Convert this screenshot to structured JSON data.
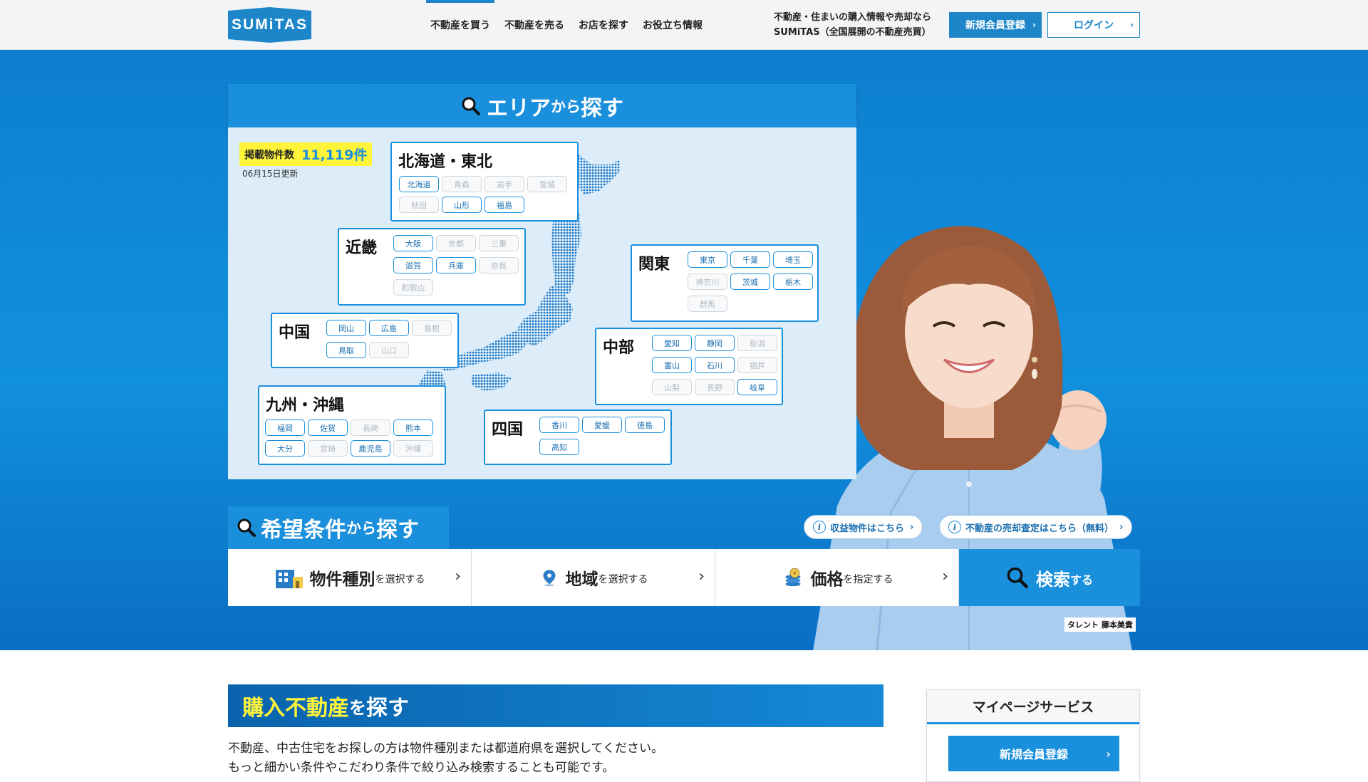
{
  "header": {
    "logo": "SUMiTAS",
    "nav": [
      "不動産を買う",
      "不動産を売る",
      "お店を探す",
      "お役立ち情報"
    ],
    "tagline_line1": "不動産・住まいの購入情報や売却なら",
    "tagline_line2": "SUMiTAS（全国展開の不動産売買）",
    "register_label": "新規会員登録",
    "login_label": "ログイン"
  },
  "area_search": {
    "title_main": "エリア",
    "title_from": "から",
    "title_search": "探す",
    "count_label": "掲載物件数",
    "count_value": "11,119件",
    "updated": "06月15日更新",
    "regions": {
      "hokkaido_tohoku": {
        "name": "北海道・東北",
        "prefs": [
          {
            "name": "北海道",
            "active": true
          },
          {
            "name": "青森",
            "active": false
          },
          {
            "name": "岩手",
            "active": false
          },
          {
            "name": "宮城",
            "active": false
          },
          {
            "name": "秋田",
            "active": false
          },
          {
            "name": "山形",
            "active": true
          },
          {
            "name": "福島",
            "active": true
          }
        ]
      },
      "kinki": {
        "name": "近畿",
        "prefs": [
          {
            "name": "大阪",
            "active": true
          },
          {
            "name": "京都",
            "active": false
          },
          {
            "name": "三重",
            "active": false
          },
          {
            "name": "滋賀",
            "active": true
          },
          {
            "name": "兵庫",
            "active": true
          },
          {
            "name": "奈良",
            "active": false
          },
          {
            "name": "和歌山",
            "active": false
          }
        ]
      },
      "kanto": {
        "name": "関東",
        "prefs": [
          {
            "name": "東京",
            "active": true
          },
          {
            "name": "千葉",
            "active": true
          },
          {
            "name": "埼玉",
            "active": true
          },
          {
            "name": "神奈川",
            "active": false
          },
          {
            "name": "茨城",
            "active": true
          },
          {
            "name": "栃木",
            "active": true
          },
          {
            "name": "群馬",
            "active": false
          }
        ]
      },
      "chugoku": {
        "name": "中国",
        "prefs": [
          {
            "name": "岡山",
            "active": true
          },
          {
            "name": "広島",
            "active": true
          },
          {
            "name": "島根",
            "active": false
          },
          {
            "name": "鳥取",
            "active": true
          },
          {
            "name": "山口",
            "active": false
          }
        ]
      },
      "chubu": {
        "name": "中部",
        "prefs": [
          {
            "name": "愛知",
            "active": true
          },
          {
            "name": "静岡",
            "active": true
          },
          {
            "name": "新潟",
            "active": false
          },
          {
            "name": "富山",
            "active": true
          },
          {
            "name": "石川",
            "active": true
          },
          {
            "name": "福井",
            "active": false
          },
          {
            "name": "山梨",
            "active": false
          },
          {
            "name": "長野",
            "active": false
          },
          {
            "name": "岐阜",
            "active": true
          }
        ]
      },
      "kyushu": {
        "name": "九州・沖縄",
        "prefs": [
          {
            "name": "福岡",
            "active": true
          },
          {
            "name": "佐賀",
            "active": true
          },
          {
            "name": "長崎",
            "active": false
          },
          {
            "name": "熊本",
            "active": true
          },
          {
            "name": "大分",
            "active": true
          },
          {
            "name": "宮崎",
            "active": false
          },
          {
            "name": "鹿児島",
            "active": true
          },
          {
            "name": "沖縄",
            "active": false
          }
        ]
      },
      "shikoku": {
        "name": "四国",
        "prefs": [
          {
            "name": "香川",
            "active": true
          },
          {
            "name": "愛媛",
            "active": true
          },
          {
            "name": "徳島",
            "active": true
          },
          {
            "name": "高知",
            "active": true
          }
        ]
      }
    }
  },
  "condition_search": {
    "title_main": "希望条件",
    "title_from": "から",
    "title_search": "探す",
    "items": [
      {
        "big": "物件種別",
        "small": "を選択する",
        "icon": "building-icon"
      },
      {
        "big": "地域",
        "small": "を選択する",
        "icon": "map-pin-icon"
      },
      {
        "big": "価格",
        "small": "を指定する",
        "icon": "coins-icon"
      }
    ],
    "search_big": "検索",
    "search_small": "する"
  },
  "links": {
    "income": "収益物件はこちら",
    "appraisal": "不動産の売却査定はこちら（無料）"
  },
  "talent_caption": "タレント 藤本美貴",
  "purchase": {
    "title_yellow": "購入不動産",
    "title_wo": "を",
    "title_rest": "探す",
    "desc_line1": "不動産、中古住宅をお探しの方は物件種別または都道府県を選択してください。",
    "desc_line2": "もっと細かい条件やこだわり条件で絞り込み検索することも可能です。"
  },
  "mypage": {
    "title": "マイページサービス",
    "register": "新規会員登録"
  },
  "colors": {
    "brand": "#1a8fdc",
    "highlight": "#fff43a",
    "map_bg": "#dcedf9"
  }
}
